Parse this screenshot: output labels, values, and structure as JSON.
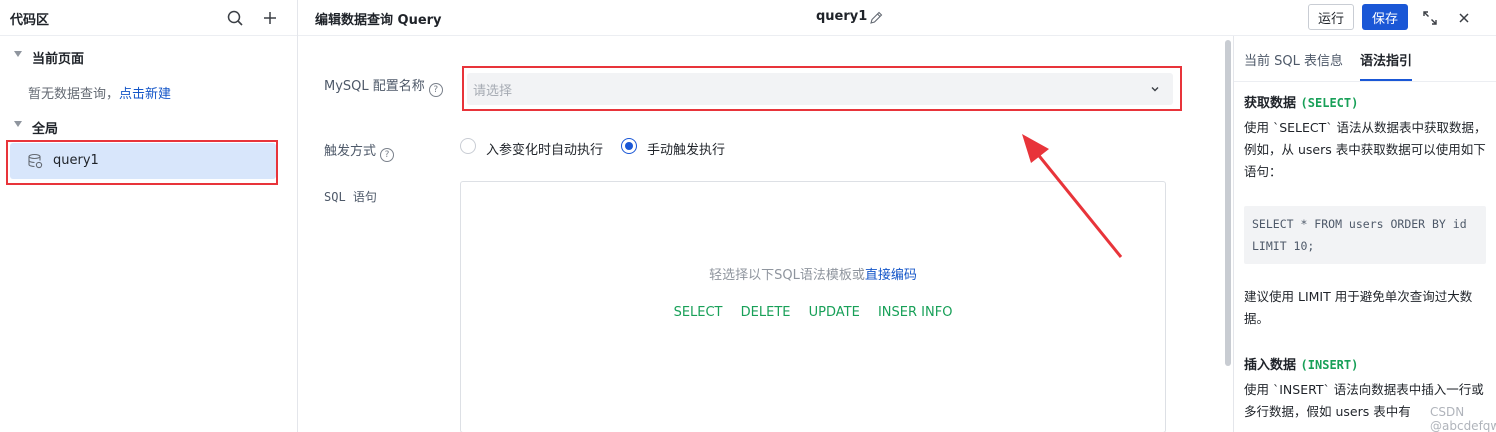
{
  "sidebar": {
    "title": "代码区",
    "current_page_label": "当前页面",
    "empty_text": "暂无数据查询，",
    "create_link": "点击新建",
    "global_label": "全局",
    "items": [
      {
        "label": "query1"
      }
    ]
  },
  "header": {
    "editor_title": "编辑数据查询 Query",
    "query_name": "query1",
    "run_label": "运行",
    "save_label": "保存"
  },
  "form": {
    "mysql_label": "MySQL 配置名称",
    "mysql_placeholder": "请选择",
    "trigger_label": "触发方式",
    "trigger_options": [
      {
        "label": "入参变化时自动执行",
        "selected": false
      },
      {
        "label": "手动触发执行",
        "selected": true
      }
    ],
    "sql_label": "SQL 语句",
    "sql_hint": "轻选择以下SQL语法模板或",
    "sql_hint_link": "直接编码",
    "templates": [
      "SELECT",
      "DELETE",
      "UPDATE",
      "INSER INFO"
    ]
  },
  "right_panel": {
    "tabs": [
      "当前 SQL 表信息",
      "语法指引"
    ],
    "active_tab": 1,
    "select_heading": "获取数据",
    "select_kw": "(SELECT)",
    "select_desc": "使用 `SELECT` 语法从数据表中获取数据，例如，从 users 表中获取数据可以使用如下语句：",
    "select_code": "SELECT * FROM users ORDER BY id LIMIT 10;",
    "limit_desc": "建议使用 LIMIT 用于避免单次查询过大数据。",
    "insert_heading": "插入数据",
    "insert_kw": "(INSERT)",
    "insert_desc": "使用 `INSERT` 语法向数据表中插入一行或多行数据，假如 users 表中有"
  },
  "watermark": "CSDN @abcdefqw",
  "colors": {
    "primary": "#1a57d6",
    "highlight": "#e8343a",
    "template_green": "#18a058",
    "selected_item": "#d8e6fb"
  }
}
